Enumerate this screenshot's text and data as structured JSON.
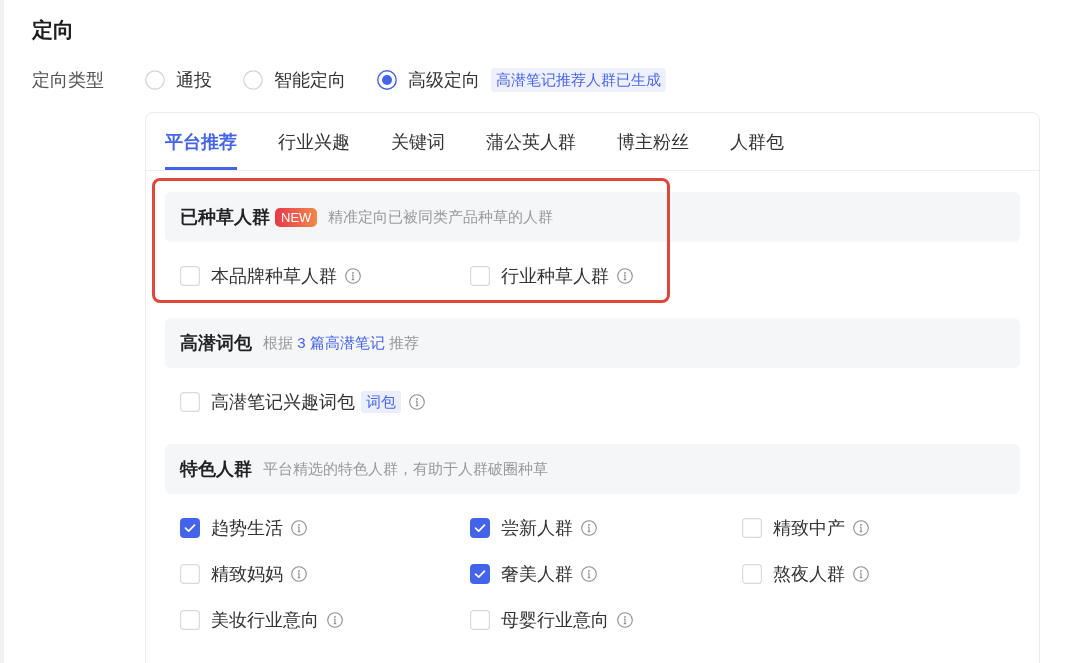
{
  "heading": "定向",
  "targeting_type": {
    "label": "定向类型",
    "options": [
      {
        "label": "通投",
        "selected": false
      },
      {
        "label": "智能定向",
        "selected": false
      },
      {
        "label": "高级定向",
        "selected": true
      }
    ],
    "note": "高潜笔记推荐人群已生成"
  },
  "tabs": [
    {
      "label": "平台推荐",
      "selected": true
    },
    {
      "label": "行业兴趣",
      "selected": false
    },
    {
      "label": "关键词",
      "selected": false
    },
    {
      "label": "蒲公英人群",
      "selected": false
    },
    {
      "label": "博主粉丝",
      "selected": false
    },
    {
      "label": "人群包",
      "selected": false
    }
  ],
  "sections": [
    {
      "title": "已种草人群",
      "badge": "NEW",
      "description": [
        {
          "kind": "text",
          "text": "精准定向已被同类产品种草的人群"
        }
      ],
      "highlighted": true,
      "items": [
        {
          "label": "本品牌种草人群",
          "checked": false,
          "info": true
        },
        {
          "label": "行业种草人群",
          "checked": false,
          "info": true
        }
      ]
    },
    {
      "title": "高潜词包",
      "description": [
        {
          "kind": "text",
          "text": "根据"
        },
        {
          "kind": "link",
          "text": "3 篇高潜笔记"
        },
        {
          "kind": "text",
          "text": "推荐"
        }
      ],
      "highlighted": false,
      "items": [
        {
          "label": "高潜笔记兴趣词包",
          "tag": "词包",
          "checked": false,
          "info": true
        }
      ]
    },
    {
      "title": "特色人群",
      "description": [
        {
          "kind": "text",
          "text": "平台精选的特色人群，有助于人群破圈种草"
        }
      ],
      "highlighted": false,
      "items": [
        {
          "label": "趋势生活",
          "checked": true,
          "info": true
        },
        {
          "label": "尝新人群",
          "checked": true,
          "info": true
        },
        {
          "label": "精致中产",
          "checked": false,
          "info": true
        },
        {
          "label": "精致妈妈",
          "checked": false,
          "info": true
        },
        {
          "label": "奢美人群",
          "checked": true,
          "info": true
        },
        {
          "label": "熬夜人群",
          "checked": false,
          "info": true
        },
        {
          "label": "美妆行业意向",
          "checked": false,
          "info": true
        },
        {
          "label": "母婴行业意向",
          "checked": false,
          "info": true
        }
      ]
    }
  ]
}
